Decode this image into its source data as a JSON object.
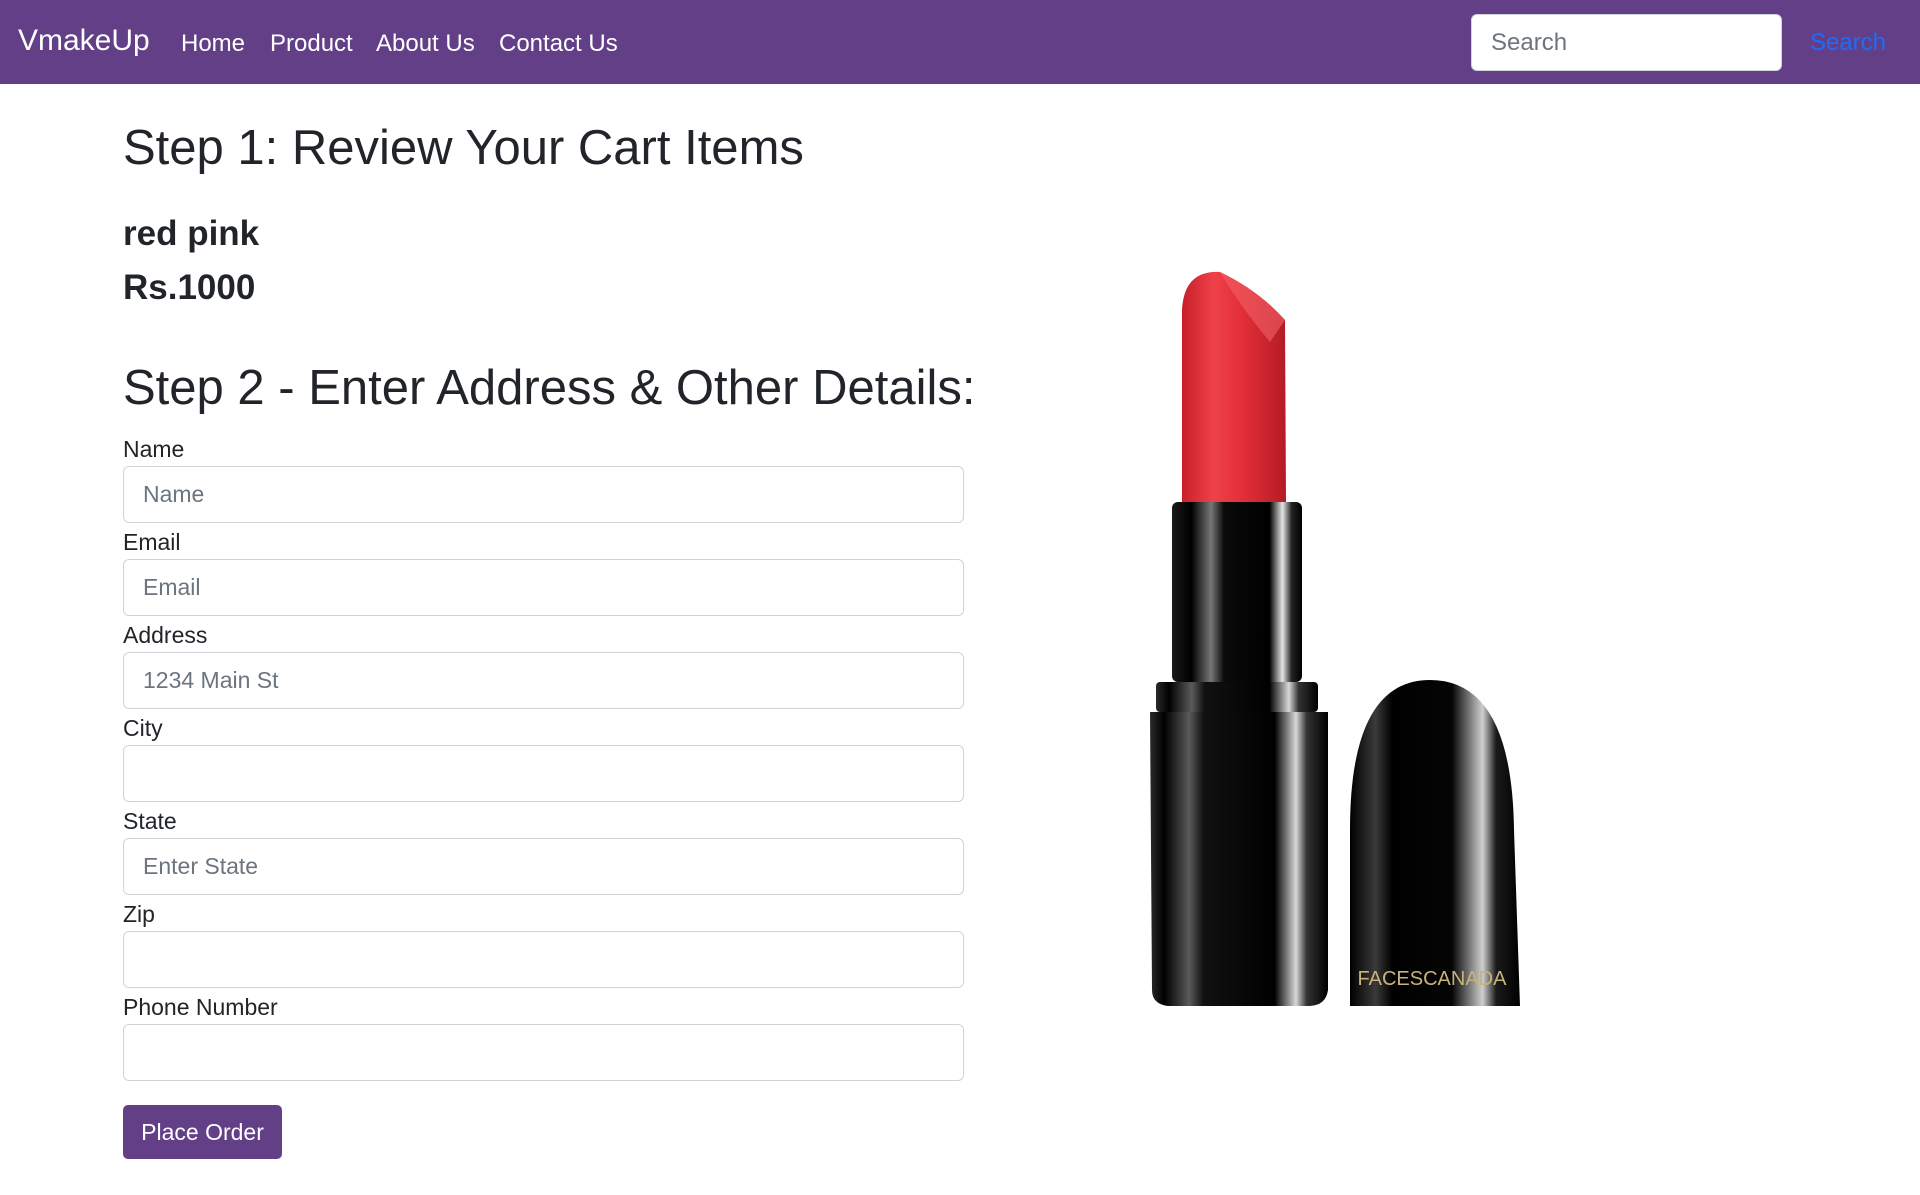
{
  "navbar": {
    "brand": "VmakeUp",
    "links": [
      "Home",
      "Product",
      "About Us",
      "Contact Us"
    ],
    "search_placeholder": "Search",
    "search_button": "Search",
    "bg_color": "#633f87"
  },
  "cart": {
    "heading": "Step 1: Review Your Cart Items",
    "item_name": "red pink",
    "item_price": "Rs.1000"
  },
  "form": {
    "heading": "Step 2 - Enter Address & Other Details:",
    "fields": [
      {
        "label": "Name",
        "placeholder": "Name",
        "value": ""
      },
      {
        "label": "Email",
        "placeholder": "Email",
        "value": ""
      },
      {
        "label": "Address",
        "placeholder": "1234 Main St",
        "value": ""
      },
      {
        "label": "City",
        "placeholder": "",
        "value": ""
      },
      {
        "label": "State",
        "placeholder": "Enter State",
        "value": ""
      },
      {
        "label": "Zip",
        "placeholder": "",
        "value": ""
      },
      {
        "label": "Phone Number",
        "placeholder": "",
        "value": ""
      }
    ],
    "submit_label": "Place Order"
  },
  "product_image": {
    "brand_text": "FACESCANADA",
    "lipstick_color": "#e0303a",
    "case_color": "#0a0a0a"
  }
}
